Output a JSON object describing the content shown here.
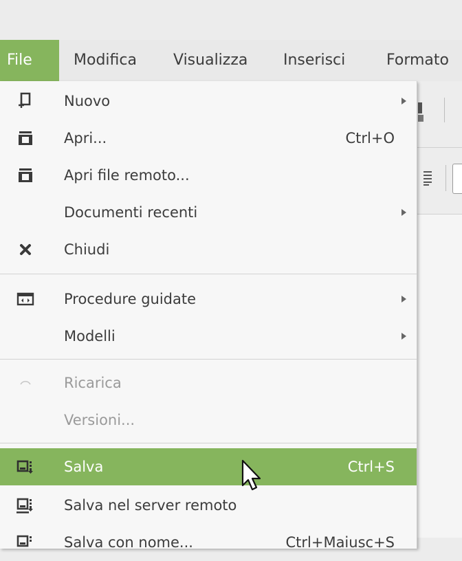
{
  "menubar": {
    "items": [
      {
        "label": "File",
        "active": true
      },
      {
        "label": "Modifica"
      },
      {
        "label": "Visualizza"
      },
      {
        "label": "Inserisci"
      },
      {
        "label": "Formato"
      }
    ]
  },
  "file_menu": {
    "items": [
      {
        "label": "Nuovo",
        "icon": "new-document-icon",
        "submenu": true
      },
      {
        "label": "Apri...",
        "shortcut": "Ctrl+O",
        "icon": "open-folder-icon"
      },
      {
        "label": "Apri file remoto...",
        "icon": "open-remote-icon"
      },
      {
        "label": "Documenti recenti",
        "submenu": true
      },
      {
        "label": "Chiudi",
        "icon": "close-icon"
      },
      {
        "label": "Procedure guidate",
        "icon": "wizard-icon",
        "submenu": true
      },
      {
        "label": "Modelli",
        "submenu": true
      },
      {
        "label": "Ricarica",
        "icon": "reload-icon",
        "disabled": true
      },
      {
        "label": "Versioni...",
        "disabled": true
      },
      {
        "label": "Salva",
        "shortcut": "Ctrl+S",
        "icon": "save-icon",
        "highlighted": true
      },
      {
        "label": "Salva nel server remoto",
        "icon": "save-remote-icon"
      },
      {
        "label": "Salva con nome...",
        "shortcut": "Ctrl+Maiusc+S",
        "icon": "save-as-icon"
      }
    ]
  },
  "colors": {
    "accent": "#86b55d",
    "menu_bg": "#f7f7f7",
    "text": "#3c3c3c",
    "disabled_text": "#9a9a9a"
  }
}
